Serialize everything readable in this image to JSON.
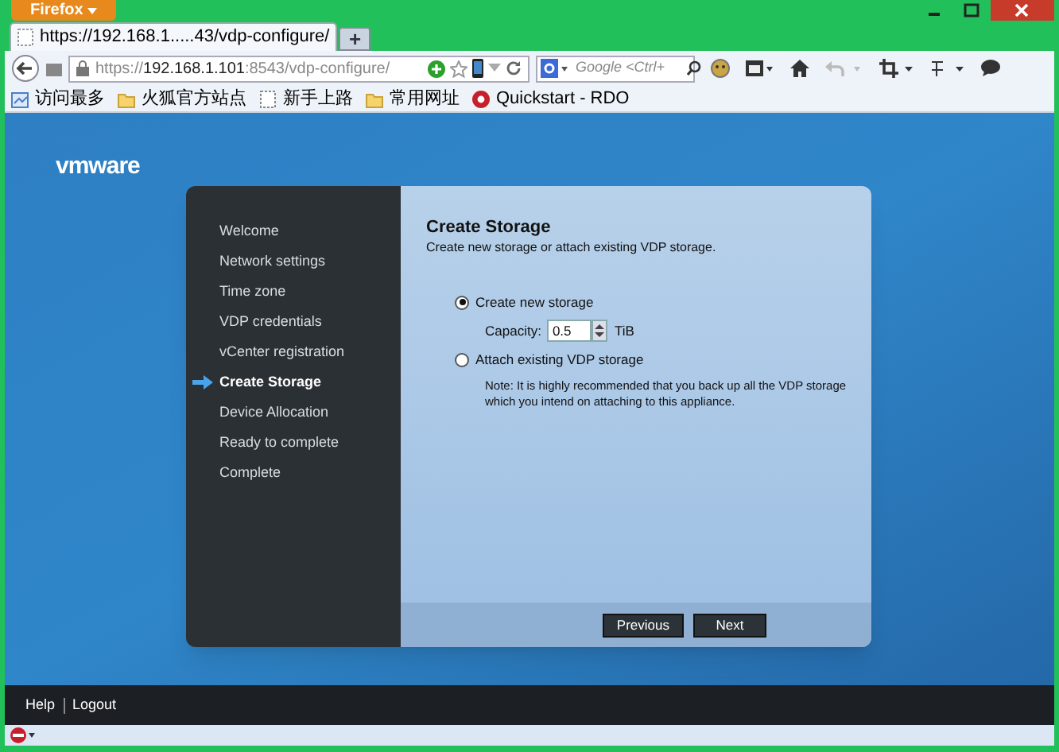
{
  "browser": {
    "menu_button": "Firefox",
    "tab": {
      "title": "https://192.168.1.....43/vdp-configure/",
      "new_tab": "+"
    },
    "url": {
      "scheme": "https://",
      "host": "192.168.1.101",
      "rest": ":8543/vdp-configure/"
    },
    "search": {
      "placeholder": "Google <Ctrl+"
    },
    "bookmarks": [
      {
        "label": "访问最多",
        "kind": "page"
      },
      {
        "label": "火狐官方站点",
        "kind": "folder"
      },
      {
        "label": "新手上路",
        "kind": "blank"
      },
      {
        "label": "常用网址",
        "kind": "folder"
      },
      {
        "label": "Quickstart - RDO",
        "kind": "rdo"
      }
    ]
  },
  "logo": "vmware",
  "wizard": {
    "steps": [
      {
        "label": "Welcome",
        "selected": false
      },
      {
        "label": "Network settings",
        "selected": false
      },
      {
        "label": "Time zone",
        "selected": false
      },
      {
        "label": "VDP credentials",
        "selected": false
      },
      {
        "label": "vCenter registration",
        "selected": false
      },
      {
        "label": "Create Storage",
        "selected": true
      },
      {
        "label": "Device Allocation",
        "selected": false
      },
      {
        "label": "Ready to complete",
        "selected": false
      },
      {
        "label": "Complete",
        "selected": false
      }
    ],
    "title": "Create Storage",
    "subtitle": "Create new storage or attach existing VDP storage.",
    "options": [
      {
        "label": "Create new storage",
        "selected": true
      },
      {
        "label": "Attach existing VDP storage",
        "selected": false
      }
    ],
    "capacity": {
      "label": "Capacity:",
      "value": "0.5",
      "unit": "TiB"
    },
    "note": "Note:  It is highly recommended that you back up all the VDP storage which you intend on attaching to this appliance.",
    "buttons": [
      "Previous",
      "Next"
    ]
  },
  "footer": {
    "links": [
      "Help",
      "Logout"
    ]
  }
}
